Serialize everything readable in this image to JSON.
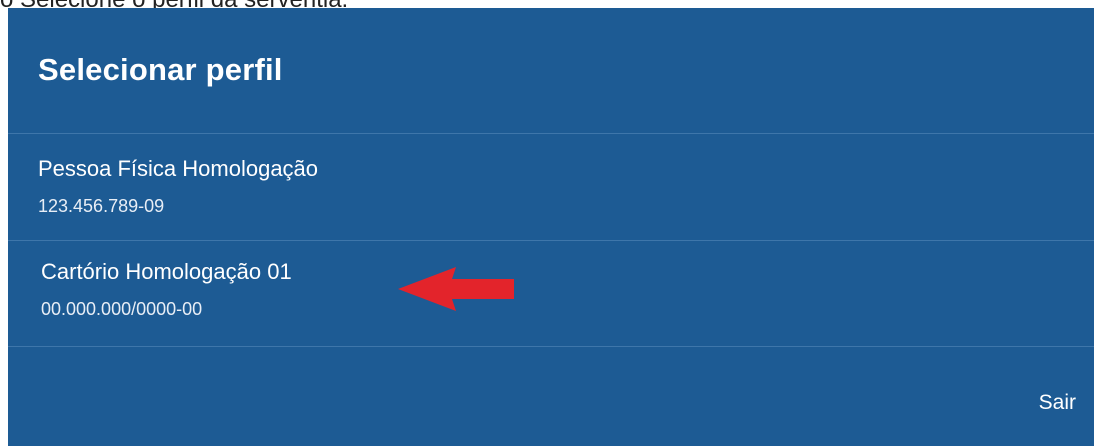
{
  "caption": "o  Selecione o perfil da serventia.",
  "dialog": {
    "title": "Selecionar perfil",
    "profiles": [
      {
        "name": "Pessoa Física Homologação",
        "document": "123.456.789-09"
      },
      {
        "name": "Cartório Homologação 01",
        "document": "00.000.000/0000-00"
      }
    ],
    "exit_label": "Sair"
  },
  "colors": {
    "dialog_background": "#1d5b94",
    "divider": "#3e76aa",
    "annotation_arrow": "#e3242b"
  }
}
